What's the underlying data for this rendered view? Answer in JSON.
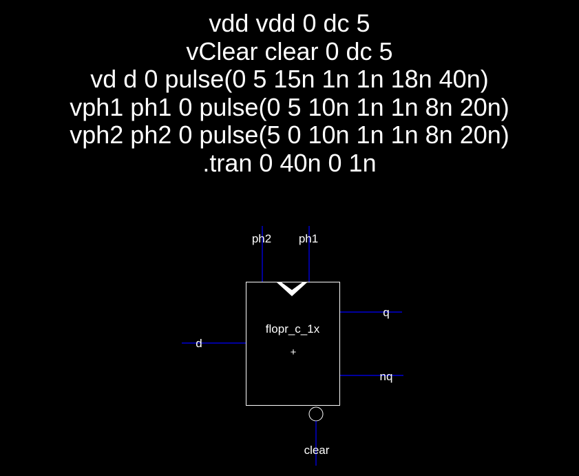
{
  "spice_lines": [
    "vdd vdd 0 dc 5",
    "vClear clear 0 dc 5",
    "vd d 0 pulse(0 5 15n 1n 1n 18n 40n)",
    "vph1 ph1 0 pulse(0 5 10n 1n 1n 8n 20n)",
    "vph2 ph2 0 pulse(5 0 10n 1n 1n 8n 20n)",
    ".tran 0 40n 0 1n"
  ],
  "symbol": {
    "cell_name": "flopr_c_1x",
    "origin_marker": "+",
    "pins": {
      "ph2": "ph2",
      "ph1": "ph1",
      "d": "d",
      "q": "q",
      "nq": "nq",
      "clear": "clear"
    }
  },
  "colors": {
    "background": "#000000",
    "text": "#ffffff",
    "wire": "#0000ff",
    "symbol_outline": "#ffffff"
  }
}
